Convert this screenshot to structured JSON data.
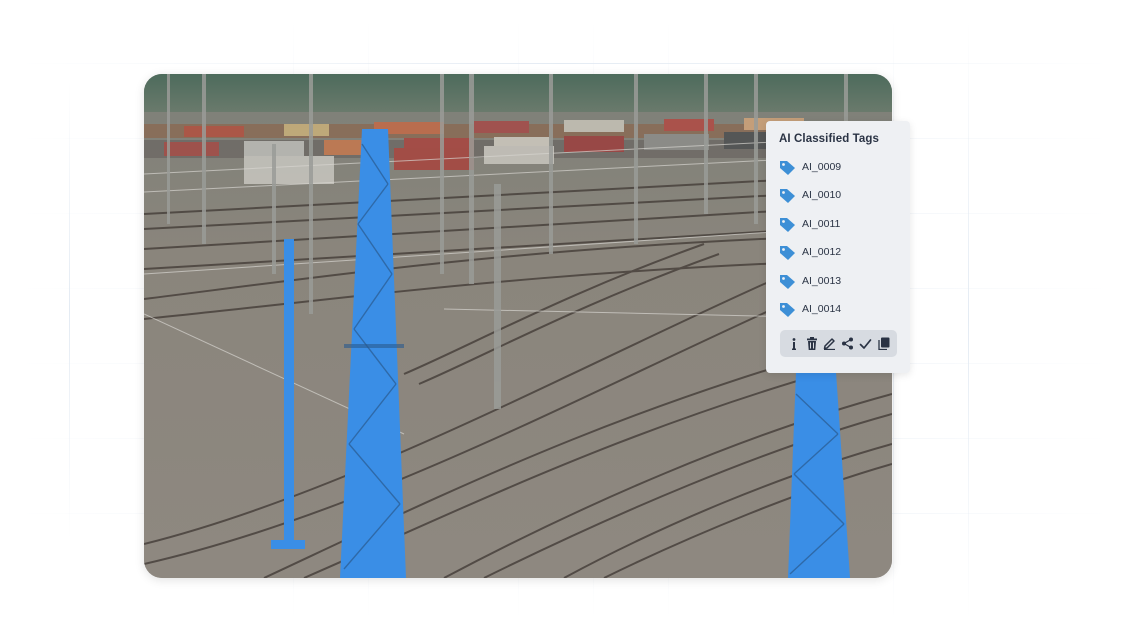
{
  "panel": {
    "title": "AI Classified Tags",
    "tags": [
      {
        "label": "AI_0009"
      },
      {
        "label": "AI_0010"
      },
      {
        "label": "AI_0011"
      },
      {
        "label": "AI_0012"
      },
      {
        "label": "AI_0013"
      },
      {
        "label": "AI_0014"
      }
    ],
    "toolbar": [
      "info-icon",
      "trash-icon",
      "edit-icon",
      "share-icon",
      "check-icon",
      "copy-icon"
    ]
  },
  "colors": {
    "accent": "#3d8fd6",
    "highlight_blue": "#3a8ee6",
    "panel_bg": "#eef0f3",
    "toolbar_bg": "#d7dbe1",
    "text": "#2a3344"
  },
  "image": {
    "subject": "railway-yard-photo",
    "highlighted_objects": [
      "catenary-mast",
      "catenary-mast",
      "catenary-mast"
    ]
  }
}
